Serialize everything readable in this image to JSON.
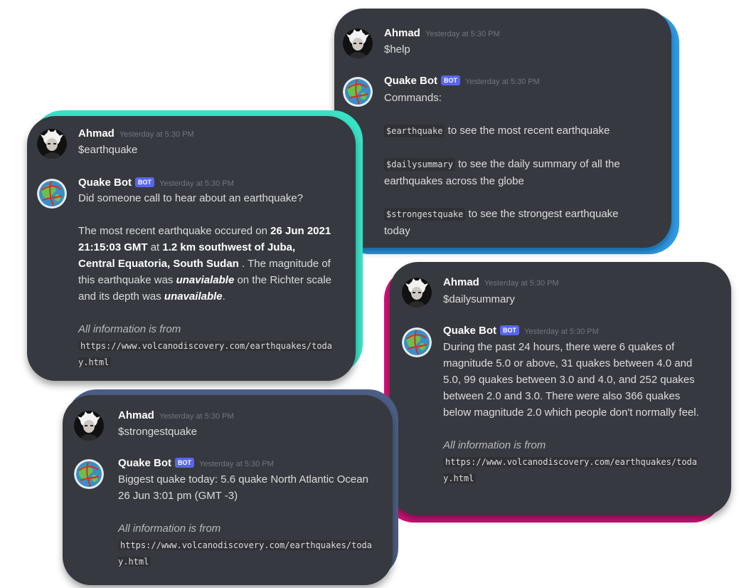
{
  "user": {
    "name": "Ahmad",
    "timestamp": "Yesterday at 5:30 PM"
  },
  "bot": {
    "name": "Quake Bot",
    "tag": "BOT",
    "timestamp": "Yesterday at 5:30 PM"
  },
  "colors": {
    "teal": "#39e1c6",
    "blue": "#2f9be8",
    "magenta": "#d0137a",
    "slate": "#4c5e86",
    "card": "#36393f"
  },
  "help_card": {
    "command": "$help",
    "intro": "Commands:",
    "items": [
      {
        "code": "$earthquake",
        "text": " to see the most recent earthquake"
      },
      {
        "code": "$dailysummary",
        "text": " to see the daily summary of all the earthquakes across the globe"
      },
      {
        "code": "$strongestquake",
        "text": " to see the strongest earthquake today"
      }
    ]
  },
  "earthquake_card": {
    "command": "$earthquake",
    "line1": "Did someone call to hear about an earthquake?",
    "p_a": "The most recent earthquake occured on ",
    "p_date": "26 Jun 2021 21:15:03 GMT",
    "p_b": " at ",
    "p_loc": "1.2 km southwest of Juba, Central Equatoria, South Sudan",
    "p_c": " . The magnitude of this earthquake was ",
    "p_mag": "unavialable",
    "p_d": " on the Richter scale and its depth was ",
    "p_depth": "unavailable",
    "p_e": ".",
    "source_label": "All information is from",
    "source_url": "https://www.volcanodiscovery.com/earthquakes/today.html"
  },
  "daily_card": {
    "command": "$dailysummary",
    "summary": "During the past 24 hours, there were 6 quakes of magnitude 5.0 or above, 31 quakes between 4.0 and 5.0, 99 quakes between 3.0 and 4.0, and 252 quakes between 2.0 and 3.0. There were also 366 quakes below magnitude 2.0 which people don't normally feel.",
    "source_label": "All information is from",
    "source_url": "https://www.volcanodiscovery.com/earthquakes/today.html"
  },
  "strongest_card": {
    "command": "$strongestquake",
    "summary": "Biggest quake today: 5.6 quake North Atlantic Ocean 26 Jun 3:01 pm (GMT -3)",
    "source_label": "All information is from",
    "source_url": "https://www.volcanodiscovery.com/earthquakes/today.html"
  }
}
